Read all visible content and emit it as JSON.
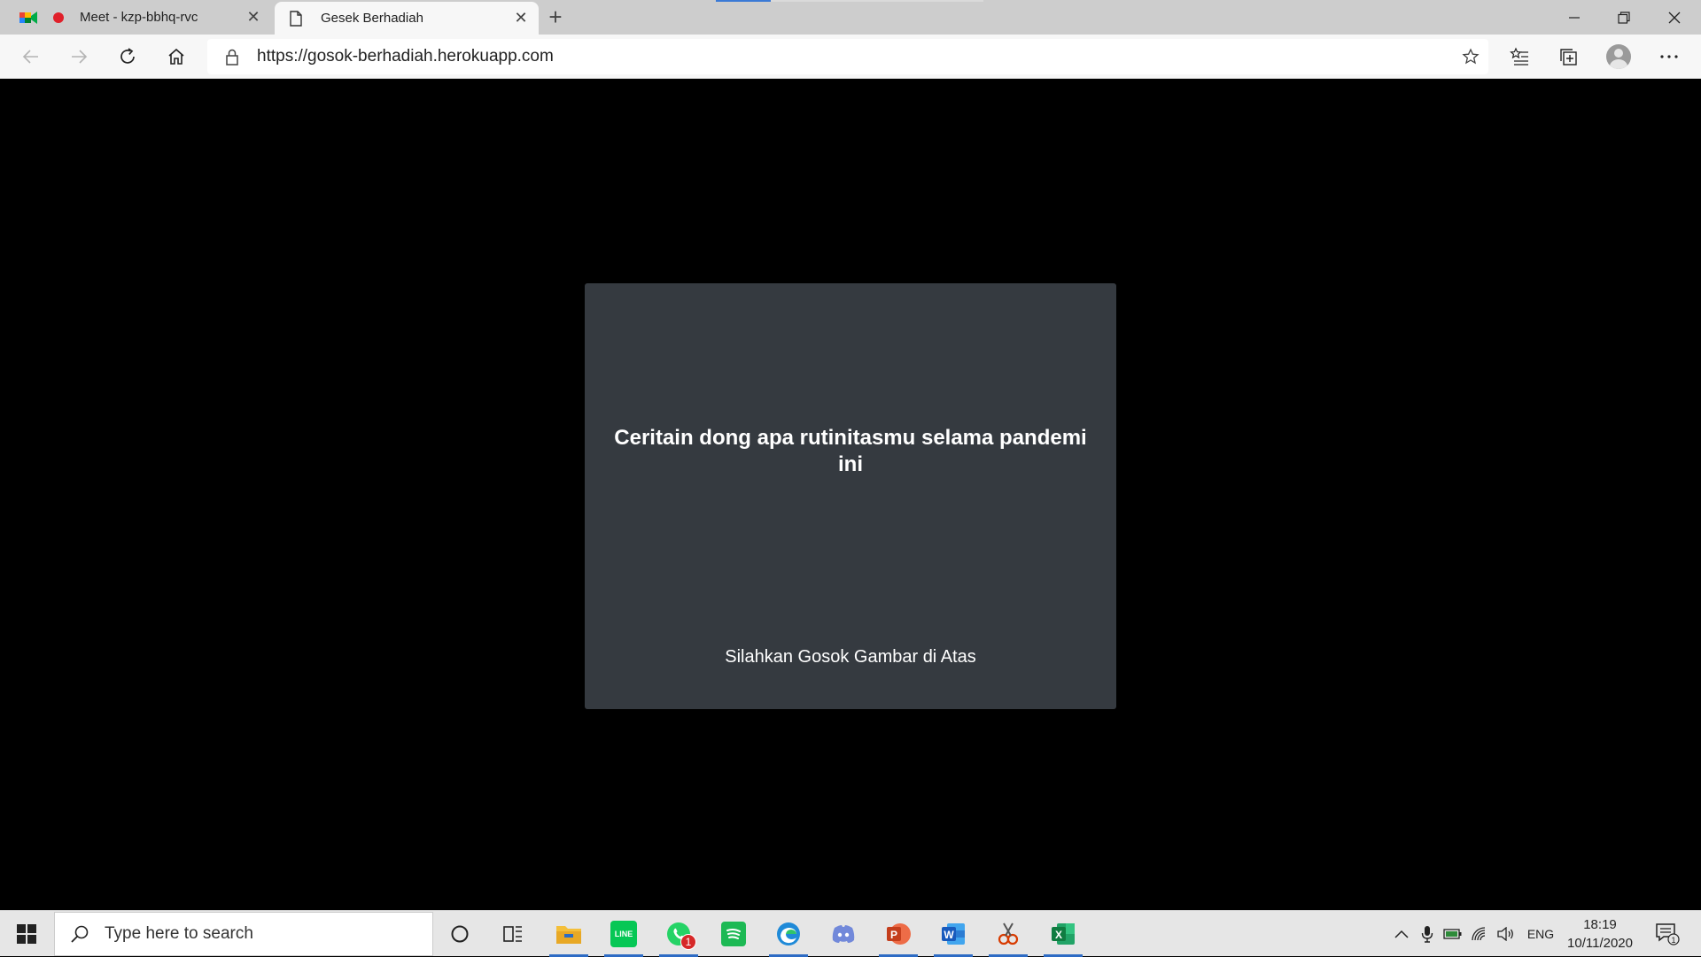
{
  "browser": {
    "tabs": [
      {
        "title": "Meet - kzp-bbhq-rvc",
        "active": false,
        "recording": true
      },
      {
        "title": "Gesek Berhadiah",
        "active": true
      }
    ],
    "address": "https://gosok-berhadiah.herokuapp.com"
  },
  "page": {
    "question": "Ceritain dong apa rutinitasmu selama pandemi ini",
    "hint": "Silahkan Gosok Gambar di Atas",
    "card_color": "#353a40"
  },
  "taskbar": {
    "search_placeholder": "Type here to search",
    "apps": [
      {
        "name": "file-explorer",
        "running": true
      },
      {
        "name": "line",
        "label": "LINE",
        "running": true
      },
      {
        "name": "whatsapp",
        "badge": "1",
        "running": true
      },
      {
        "name": "spotify",
        "running": false
      },
      {
        "name": "edge",
        "running": true
      },
      {
        "name": "discord",
        "running": false
      },
      {
        "name": "powerpoint",
        "label": "P",
        "running": true
      },
      {
        "name": "word",
        "label": "W",
        "running": true
      },
      {
        "name": "snipping-tool",
        "running": true
      },
      {
        "name": "excel",
        "label": "X",
        "running": true
      }
    ],
    "language": "ENG",
    "time": "18:19",
    "date": "10/11/2020",
    "notifications": "1"
  }
}
